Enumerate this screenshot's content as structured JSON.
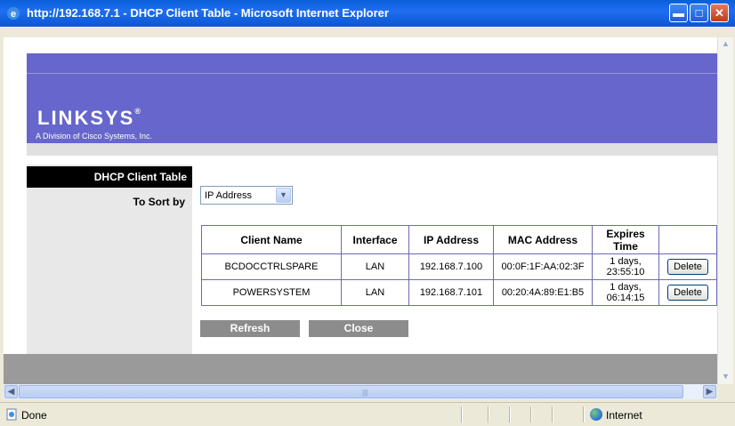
{
  "window": {
    "title": "http://192.168.7.1 - DHCP Client Table - Microsoft Internet Explorer"
  },
  "brand": {
    "logo": "LINKSYS",
    "registered": "®",
    "tagline": "A Division of Cisco Systems, Inc."
  },
  "page": {
    "section_title": "DHCP Client Table",
    "sort_label": "To Sort by",
    "sort_value": "IP Address"
  },
  "table": {
    "headers": {
      "client_name": "Client Name",
      "interface": "Interface",
      "ip": "IP Address",
      "mac": "MAC Address",
      "expires": "Expires Time"
    },
    "rows": [
      {
        "client_name": "BCDOCCTRLSPARE",
        "interface": "LAN",
        "ip": "192.168.7.100",
        "mac": "00:0F:1F:AA:02:3F",
        "expires_1": "1 days,",
        "expires_2": "23:55:10",
        "action": "Delete"
      },
      {
        "client_name": "POWERSYSTEM",
        "interface": "LAN",
        "ip": "192.168.7.101",
        "mac": "00:20:4A:89:E1:B5",
        "expires_1": "1 days,",
        "expires_2": "06:14:15",
        "action": "Delete"
      }
    ]
  },
  "buttons": {
    "refresh": "Refresh",
    "close": "Close"
  },
  "status": {
    "text": "Done",
    "zone": "Internet"
  },
  "icons": {
    "min": "minimize-icon",
    "max": "maximize-icon",
    "close": "close-icon",
    "ie": "ie-icon",
    "globe": "globe-icon"
  }
}
